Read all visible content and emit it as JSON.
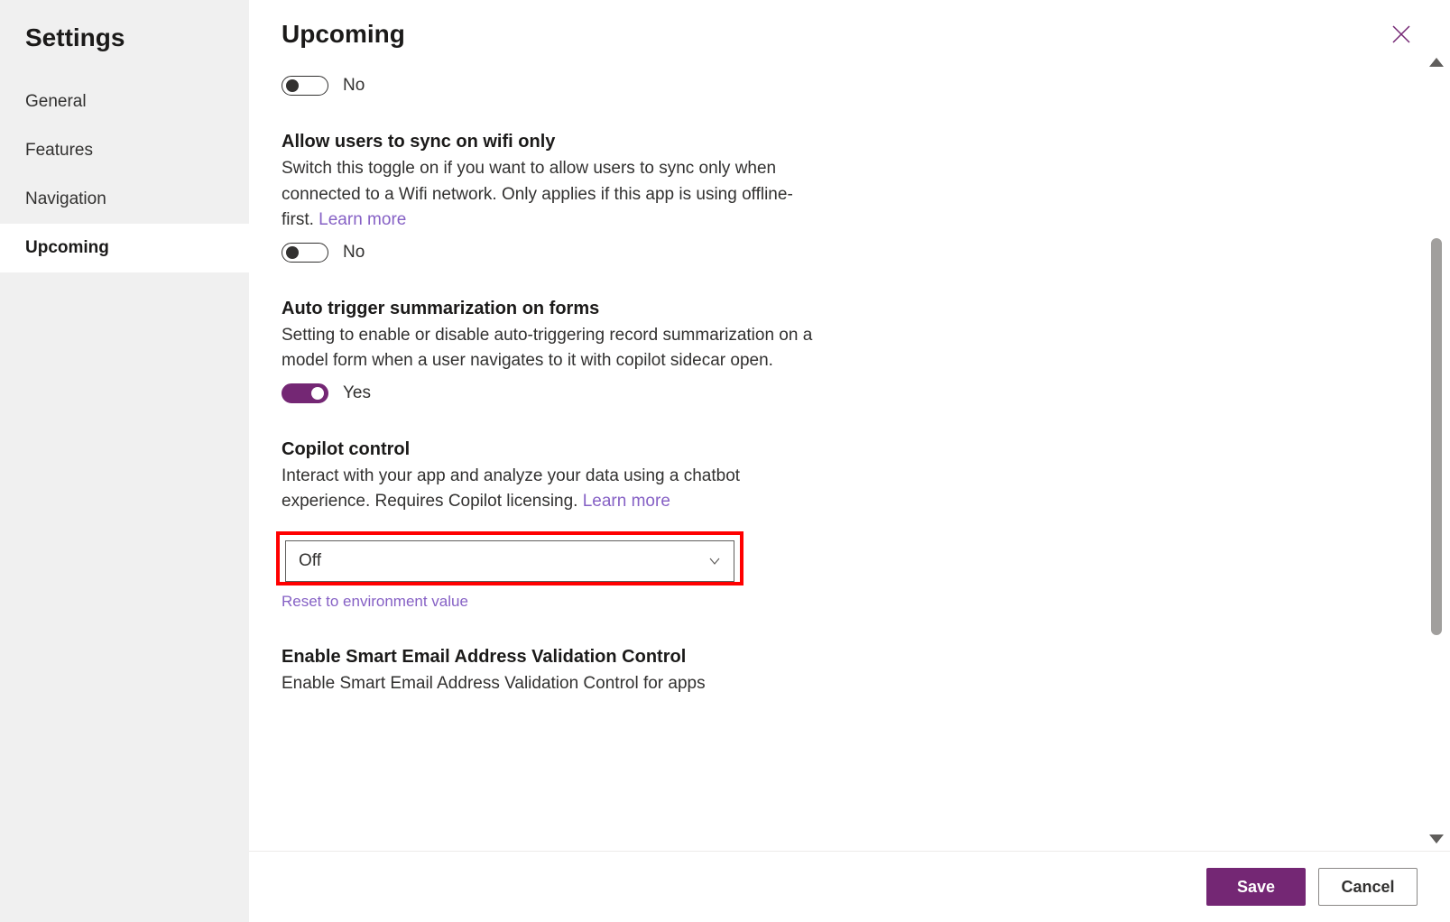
{
  "sidebar": {
    "title": "Settings",
    "items": [
      {
        "label": "General"
      },
      {
        "label": "Features"
      },
      {
        "label": "Navigation"
      },
      {
        "label": "Upcoming"
      }
    ],
    "active_index": 3
  },
  "header": {
    "title": "Upcoming"
  },
  "sections": {
    "first_toggle": {
      "state_label": "No"
    },
    "wifi": {
      "title": "Allow users to sync on wifi only",
      "desc": "Switch this toggle on if you want to allow users to sync only when connected to a Wifi network. Only applies if this app is using offline-first. ",
      "link": "Learn more",
      "state_label": "No"
    },
    "auto_summary": {
      "title": "Auto trigger summarization on forms",
      "desc": "Setting to enable or disable auto-triggering record summarization on a model form when a user navigates to it with copilot sidecar open.",
      "state_label": "Yes"
    },
    "copilot": {
      "title": "Copilot control",
      "desc": "Interact with your app and analyze your data using a chatbot experience. Requires Copilot licensing. ",
      "link": "Learn more",
      "value": "Off",
      "reset": "Reset to environment value"
    },
    "smart_email": {
      "title": "Enable Smart Email Address Validation Control",
      "desc": "Enable Smart Email Address Validation Control for apps"
    }
  },
  "footer": {
    "save": "Save",
    "cancel": "Cancel"
  },
  "colors": {
    "accent": "#742774",
    "link": "#8661c5",
    "highlight_box": "#ff0000"
  }
}
